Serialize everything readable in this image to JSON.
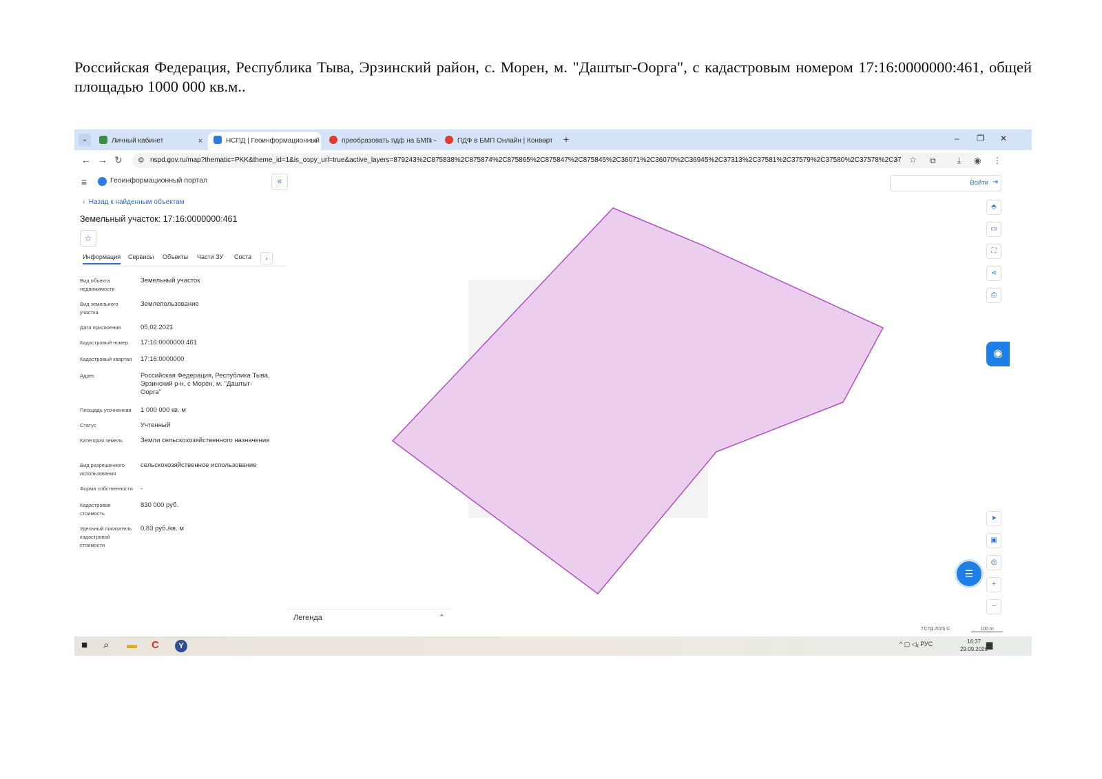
{
  "document": {
    "text": "Российская Федерация, Республика Тыва, Эрзинский район, с. Морен, м. \"Даштыг-Оорга\", с кадастровым номером 17:16:0000000:461, общей площадью 1000 000 кв.м.."
  },
  "browser": {
    "tabs": [
      {
        "label": "Личный кабинет",
        "close": "×",
        "color": "#3a8d3f"
      },
      {
        "label": "НСПД | Геоинформационный",
        "close": "×",
        "color": "#2b7de0"
      },
      {
        "label": "преобразовать пдф на БМП —",
        "close": "×",
        "color": "#e03a2f"
      },
      {
        "label": "ПДФ в БМП Онлайн | Конверт",
        "close": "×",
        "color": "#e03a2f"
      }
    ],
    "new_tab": "+",
    "dropdown": "⌄",
    "window_buttons": {
      "minimize": "–",
      "maximize": "❐",
      "close": "✕"
    },
    "nav": {
      "back": "←",
      "forward": "→",
      "reload": "↻"
    },
    "url": "nspd.gov.ru/map?thematic=PKK&theme_id=1&is_copy_url=true&active_layers=879243%2C875838%2C875874%2C875865%2C875847%2C875845%2C36071%2C36070%2C36945%2C37313%2C37581%2C37579%2C37580%2C37578%2C37577..."
  },
  "panel": {
    "portal_title": "Геоинформационный портал",
    "collapse": "«",
    "back_link": "Назад к найденным объектам",
    "object_title": "Земельный участок: 17:16:0000000:461",
    "star": "☆",
    "tabs": [
      "Информация",
      "Сервисы",
      "Объекты",
      "Части ЗУ",
      "Соста"
    ],
    "tabs_next": "›",
    "properties": [
      {
        "label": "Вид объекта недвижимости",
        "value": "Земельный участок"
      },
      {
        "label": "Вид земельного участка",
        "value": "Землепользование"
      },
      {
        "label": "Дата присвоения",
        "value": "05.02.2021"
      },
      {
        "label": "Кадастровый номер",
        "value": "17:16:0000000:461"
      },
      {
        "label": "Кадастровый квартал",
        "value": "17:16:0000000"
      },
      {
        "label": "Адрес",
        "value": "Российская Федерация, Республика Тыва, Эрзинский р-н, с Морен, м. \"Даштыг-Оорга\""
      },
      {
        "label": "Площадь уточненная",
        "value": "1 000 000 кв. м"
      },
      {
        "label": "Статус",
        "value": "Учтенный"
      },
      {
        "label": "Категория земель",
        "value": "Земли сельскохозяйственного назначения"
      },
      {
        "label": "Вид разрешенного использования",
        "value": "сельскохозяйственное использование"
      },
      {
        "label": "Форма собственности",
        "value": "-"
      },
      {
        "label": "Кадастровая стоимость",
        "value": "830 000 руб."
      },
      {
        "label": "Удельный показатель кадастровой стоимости",
        "value": "0,83 руб./кв. м"
      }
    ]
  },
  "map": {
    "login": "Войти",
    "login_icon": "⇥",
    "parcel_color": "#e8c6ec",
    "parcel_stroke": "#b24fc4",
    "tools_top": [
      "⬘",
      "▭",
      "⛶",
      "⋖",
      "⎙"
    ],
    "tools_bottom": [
      "➤",
      "▣",
      "◎",
      "+",
      "−"
    ],
    "assistant_icon": "◉",
    "chat_icon": "☰",
    "legend": "Легенда",
    "legend_toggle": "⌃",
    "scale_left": "ГСГД 2026 ©",
    "scale_right": "100 m"
  },
  "taskbar": {
    "icons": [
      "■",
      "⌕",
      "▬",
      "C",
      "Y"
    ],
    "tray": "^ ▢ ◁ᵪ РУС",
    "time": "16:37",
    "date": "29.09.2026",
    "notify": "▆"
  }
}
